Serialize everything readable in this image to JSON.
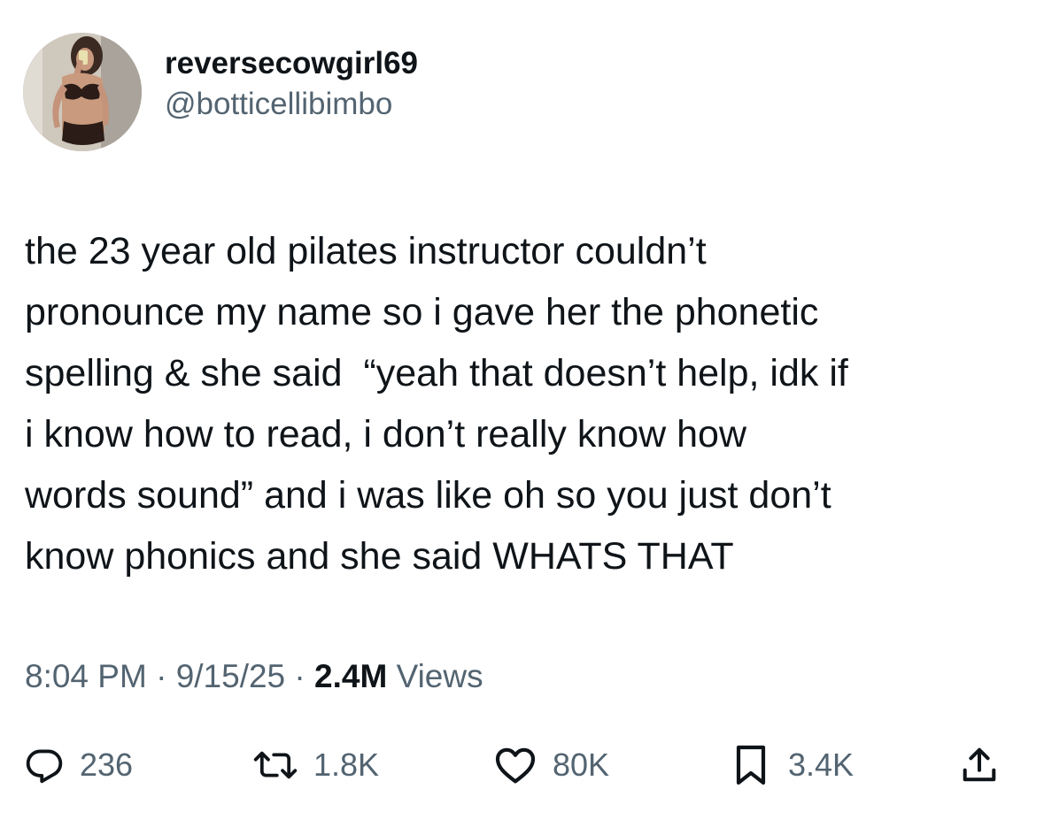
{
  "user": {
    "display_name": "reversecowgirl69",
    "handle": "@botticellibimbo",
    "avatar_icon": "user-avatar-photo"
  },
  "tweet": {
    "lines": [
      "the 23 year old pilates instructor couldn’t",
      "pronounce my name so i gave her the phonetic",
      "spelling & she said  “yeah that doesn’t help, idk if",
      "i know how to read, i don’t really know how",
      "words sound” and i was like oh so you just don’t",
      "know phonics and she said WHATS THAT"
    ]
  },
  "meta": {
    "time": "8:04 PM",
    "separator": " · ",
    "date": "9/15/25",
    "views_count": "2.4M",
    "views_label": " Views"
  },
  "actions": {
    "reply": {
      "icon": "reply-icon",
      "count": "236"
    },
    "repost": {
      "icon": "repost-icon",
      "count": "1.8K"
    },
    "like": {
      "icon": "heart-icon",
      "count": "80K"
    },
    "bookmark": {
      "icon": "bookmark-icon",
      "count": "3.4K"
    },
    "share": {
      "icon": "share-icon"
    }
  },
  "colors": {
    "text_primary": "#0f1419",
    "text_secondary": "#536471",
    "background": "#ffffff"
  }
}
